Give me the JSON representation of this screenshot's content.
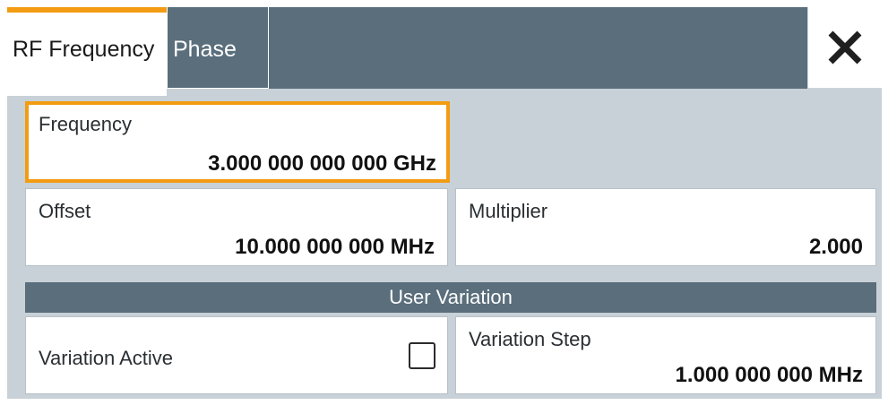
{
  "tabs": {
    "rf_frequency": "RF Frequency",
    "phase": "Phase"
  },
  "close": {
    "icon": "close-icon"
  },
  "frequency": {
    "label": "Frequency",
    "value": "3.000 000 000 000 GHz"
  },
  "offset": {
    "label": "Offset",
    "value": "10.000 000 000 MHz"
  },
  "multiplier": {
    "label": "Multiplier",
    "value": "2.000"
  },
  "user_variation": {
    "header": "User Variation",
    "active_label": "Variation Active",
    "active_checked": false,
    "step_label": "Variation Step",
    "step_value": "1.000 000 000 MHz"
  },
  "colors": {
    "accent": "#f39c12",
    "header_bg": "#5a6e7c",
    "panel_bg": "#c8d1d7"
  }
}
